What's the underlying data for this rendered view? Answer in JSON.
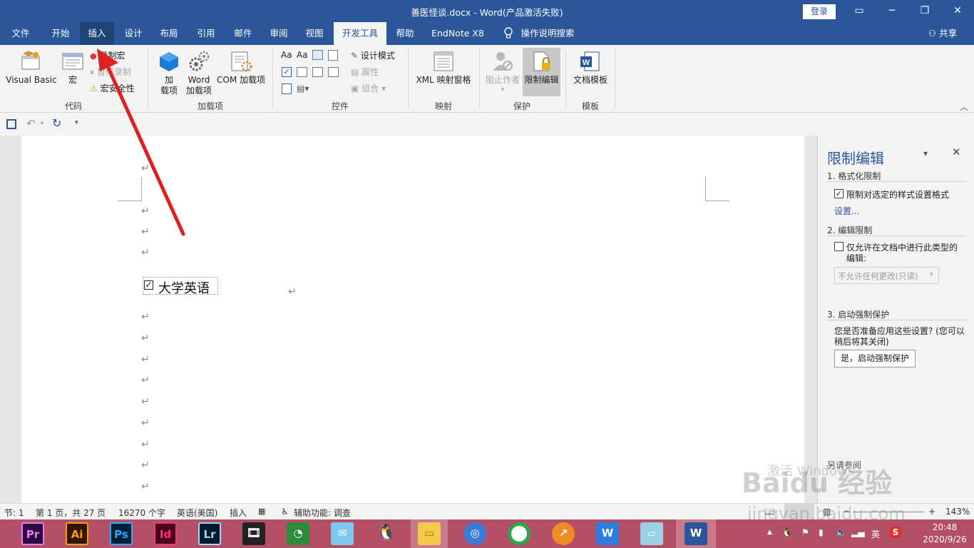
{
  "window": {
    "title": "善医怪谈.docx  -  Word(产品激活失败)",
    "login": "登录"
  },
  "tabs": [
    "文件",
    "开始",
    "插入",
    "设计",
    "布局",
    "引用",
    "邮件",
    "审阅",
    "视图",
    "开发工具",
    "帮助",
    "EndNote X8",
    "操作说明搜索"
  ],
  "share": "共享",
  "ribbon": {
    "code": {
      "label": "代码",
      "visual_basic": "Visual Basic",
      "macros": "宏",
      "record_macro": "录制宏",
      "pause_recording": "暂停录制",
      "macro_security": "宏安全性"
    },
    "addins": {
      "label": "加载项",
      "addins_line1": "加",
      "addins_line2": "载项",
      "word_addins_line1": "Word",
      "word_addins_line2": "加载项",
      "com_addins": "COM 加载项"
    },
    "controls": {
      "label": "控件",
      "design_mode": "设计模式",
      "properties": "属性",
      "group": "组合"
    },
    "mapping": {
      "label": "映射",
      "xml_pane": "XML 映射窗格"
    },
    "protect": {
      "label": "保护",
      "block_authors": "阻止作者",
      "restrict_editing": "限制编辑"
    },
    "templates": {
      "label": "模板",
      "document_template": "文档模板"
    }
  },
  "document": {
    "checkbox_text": "大学英语",
    "para_mark": "↵"
  },
  "pane": {
    "title": "限制编辑",
    "s1_title": "1. 格式化限制",
    "s1_check": "限制对选定的样式设置格式",
    "s1_link": "设置...",
    "s2_title": "2. 编辑限制",
    "s2_check_line1": "仅允许在文档中进行此类型的",
    "s2_check_line2": "编辑:",
    "s2_select": "不允许任何更改(只读)",
    "s3_title": "3. 启动强制保护",
    "s3_text_line1": "您是否准备应用这些设置? (您可以",
    "s3_text_line2": "稍后将其关闭)",
    "s3_button": "是，启动强制保护",
    "bottom_text": "另请参阅"
  },
  "status": {
    "section": "节: 1",
    "page": "第 1 页，共 27 页",
    "words": "16270 个字",
    "language": "英语(美国)",
    "mode": "插入",
    "accessibility": "辅助功能: 调查",
    "zoom": "143%"
  },
  "watermark": {
    "activate": "激活 Windows",
    "baidu": "Baidu 经验",
    "url": "jingyan.baidu.com"
  },
  "taskbar": {
    "apps": [
      "Pr",
      "Ai",
      "Ps",
      "Id",
      "Lr"
    ],
    "ime": "英",
    "time": "20:48",
    "date": "2020/9/26"
  },
  "colors": {
    "word_blue": "#2b579a",
    "taskbar": "#b34f67",
    "arrow": "#e02020"
  }
}
